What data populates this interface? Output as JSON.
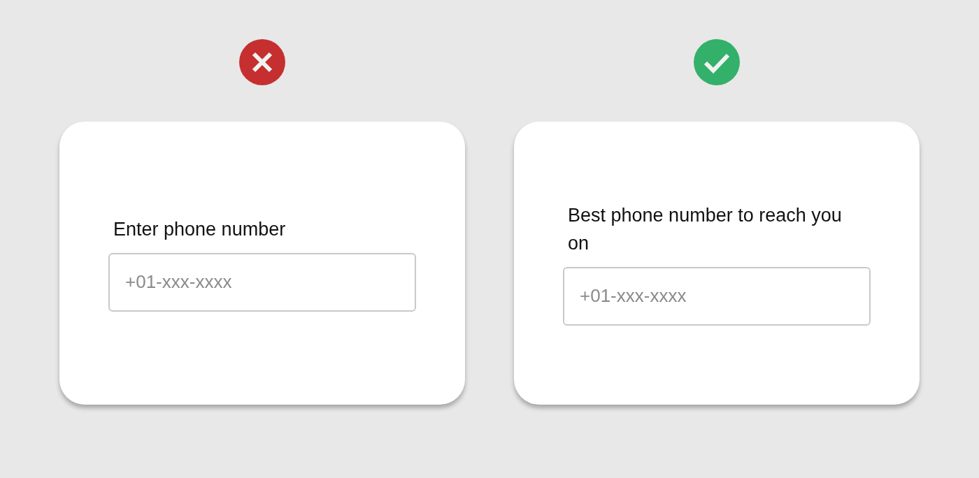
{
  "examples": [
    {
      "kind": "wrong",
      "label": "Enter phone number",
      "placeholder": "+01-xxx-xxxx"
    },
    {
      "kind": "right",
      "label": "Best phone number to reach you on",
      "placeholder": "+01-xxx-xxxx"
    }
  ]
}
